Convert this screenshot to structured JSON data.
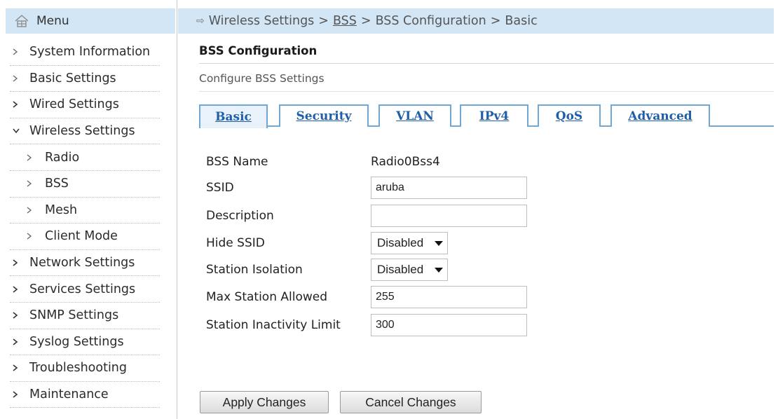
{
  "menu": {
    "label": "Menu",
    "icon": "home-icon"
  },
  "sidebar": {
    "items": [
      {
        "label": "System Information",
        "level": 0,
        "expanded": false
      },
      {
        "label": "Basic Settings",
        "level": 0,
        "expanded": false
      },
      {
        "label": "Wired Settings",
        "level": 0,
        "expanded": false
      },
      {
        "label": "Wireless Settings",
        "level": 0,
        "expanded": true
      },
      {
        "label": "Radio",
        "level": 1,
        "expanded": false
      },
      {
        "label": "BSS",
        "level": 1,
        "expanded": false
      },
      {
        "label": "Mesh",
        "level": 1,
        "expanded": false
      },
      {
        "label": "Client Mode",
        "level": 1,
        "expanded": false
      },
      {
        "label": "Network Settings",
        "level": 0,
        "expanded": false
      },
      {
        "label": "Services Settings",
        "level": 0,
        "expanded": false
      },
      {
        "label": "SNMP Settings",
        "level": 0,
        "expanded": false
      },
      {
        "label": "Syslog Settings",
        "level": 0,
        "expanded": false
      },
      {
        "label": "Troubleshooting",
        "level": 0,
        "expanded": false
      },
      {
        "label": "Maintenance",
        "level": 0,
        "expanded": false
      }
    ]
  },
  "breadcrumb": {
    "items": [
      "Wireless Settings",
      "BSS",
      "BSS Configuration",
      "Basic"
    ],
    "separator": ">"
  },
  "section": {
    "title": "BSS Configuration",
    "subtitle": "Configure BSS Settings"
  },
  "tabs": [
    {
      "label": "Basic",
      "active": true
    },
    {
      "label": "Security",
      "active": false
    },
    {
      "label": "VLAN",
      "active": false
    },
    {
      "label": "IPv4",
      "active": false
    },
    {
      "label": "QoS",
      "active": false
    },
    {
      "label": "Advanced",
      "active": false
    }
  ],
  "form": {
    "bss_name": {
      "label": "BSS Name",
      "value": "Radio0Bss4"
    },
    "ssid": {
      "label": "SSID",
      "value": "aruba"
    },
    "description": {
      "label": "Description",
      "value": ""
    },
    "hide_ssid": {
      "label": "Hide SSID",
      "value": "Disabled"
    },
    "station_isolation": {
      "label": "Station Isolation",
      "value": "Disabled"
    },
    "max_station": {
      "label": "Max Station Allowed",
      "value": "255"
    },
    "inactivity": {
      "label": "Station Inactivity Limit",
      "value": "300"
    }
  },
  "buttons": {
    "apply": "Apply Changes",
    "cancel": "Cancel Changes"
  },
  "colors": {
    "header_bg": "#d3e6f5",
    "tab_border": "#6fa7d6",
    "tab_text": "#1f5ea8"
  }
}
